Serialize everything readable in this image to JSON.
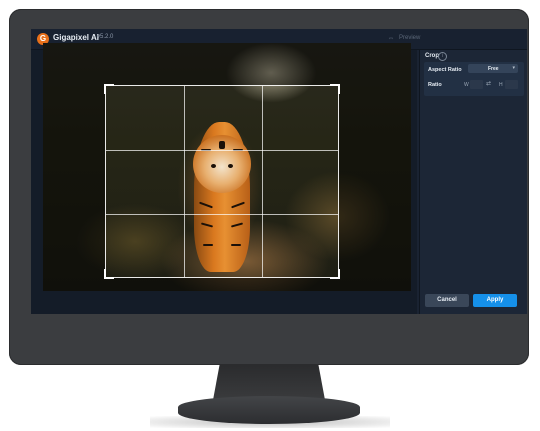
{
  "app": {
    "title": "Gigapixel AI",
    "version": "v5.2.0",
    "logo_letter": "G"
  },
  "toolbar": {
    "compare_icon": "split-compare-icon",
    "preview_label": "Preview"
  },
  "panel": {
    "title": "Crop",
    "info_icon": "i",
    "aspect_ratio_label": "Aspect Ratio",
    "aspect_ratio_value": "Free",
    "ratio_label": "Ratio",
    "width_prefix": "W",
    "height_prefix": "H",
    "width_value": "",
    "height_value": "",
    "swap_icon": "⇄",
    "cancel_label": "Cancel",
    "apply_label": "Apply"
  },
  "colors": {
    "accent": "#1590ea",
    "logo": "#e8701a",
    "app_bg": "#1a2332",
    "bezel": "#3b3d40"
  }
}
